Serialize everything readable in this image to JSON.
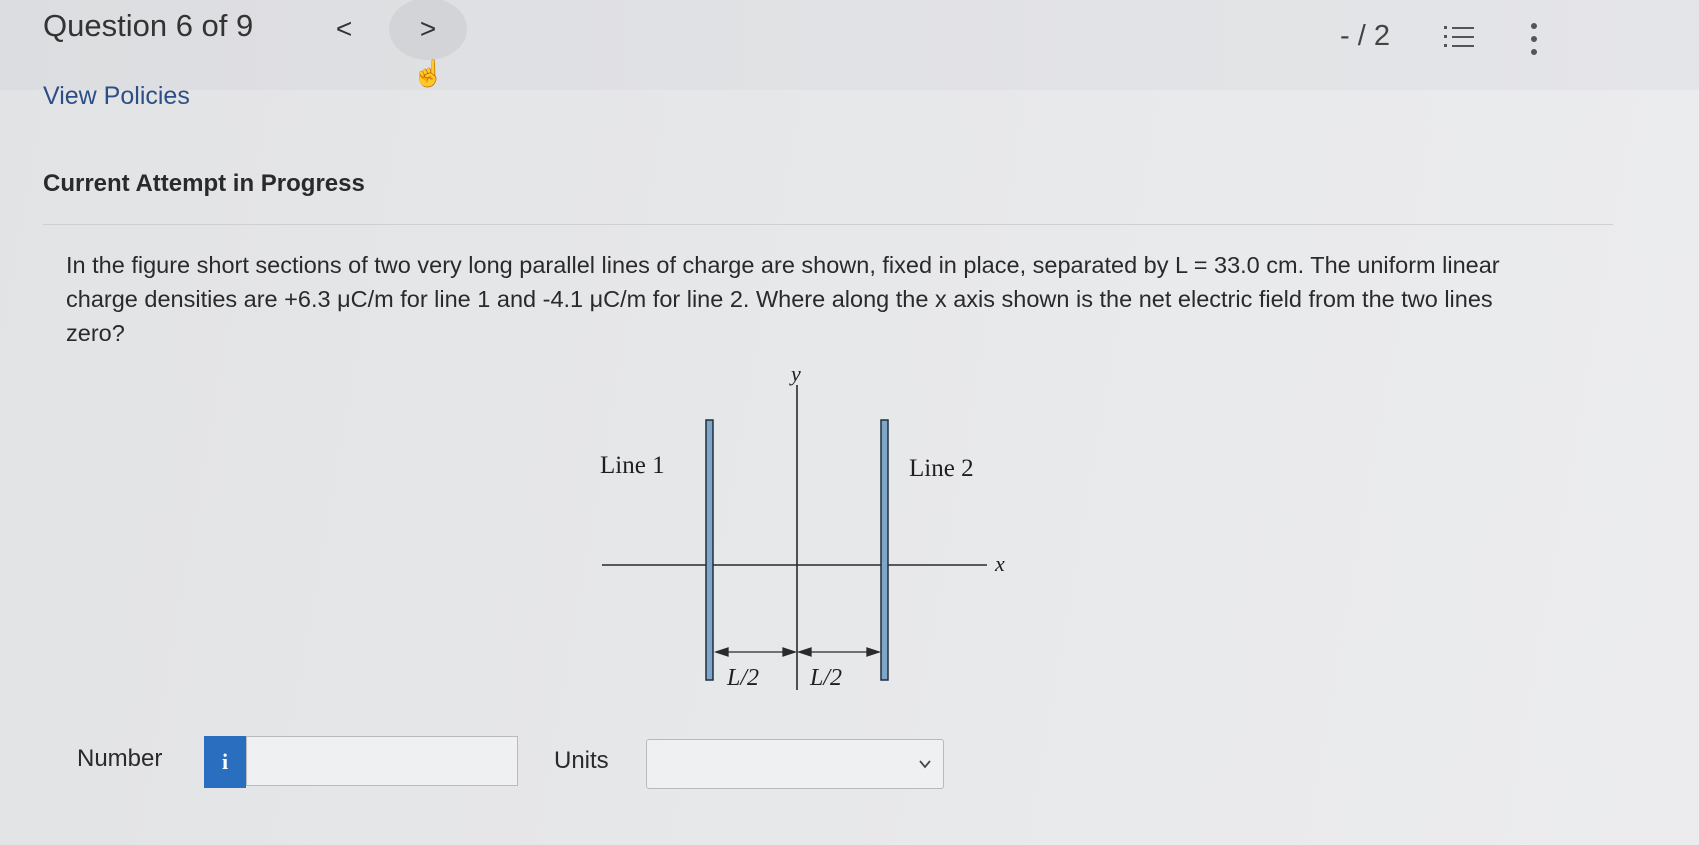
{
  "header": {
    "question_label": "Question 6 of 9",
    "prev_symbol": "<",
    "next_symbol": ">",
    "score": "- / 2",
    "list_icon": "list-icon",
    "more_icon": "more-vertical-icon"
  },
  "policies_link": "View Policies",
  "attempt_status": "Current Attempt in Progress",
  "question_text": "In the figure short sections of two very long parallel lines of charge are shown, fixed in place, separated by L = 33.0 cm. The uniform linear charge densities are +6.3 μC/m for line 1 and -4.1 μC/m for line 2. Where along the x axis shown is the net electric field from the two lines zero?",
  "figure": {
    "y_label": "y",
    "x_label": "x",
    "line1_label": "Line 1",
    "line2_label": "Line 2",
    "left_span_label": "L/2",
    "right_span_label": "L/2"
  },
  "answer": {
    "number_label": "Number",
    "info_symbol": "i",
    "number_value": "",
    "units_label": "Units",
    "units_value": ""
  }
}
